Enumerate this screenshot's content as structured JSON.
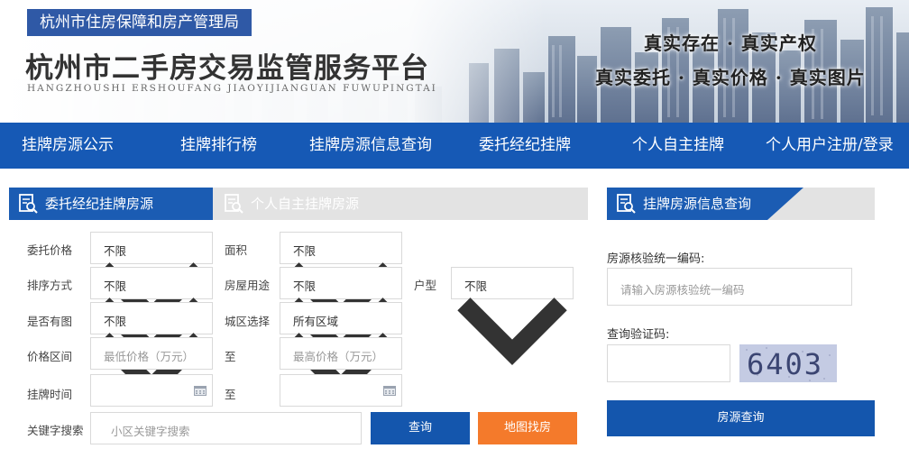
{
  "header": {
    "bureau": "杭州市住房保障和房产管理局",
    "title": "杭州市二手房交易监管服务平台",
    "pinyin": "HANGZHOUSHI  ERSHOUFANG  JIAOYIJIANGUAN  FUWUPINGTAI",
    "slogan_line1": "真实存在 · 真实产权",
    "slogan_line2": "真实委托 · 真实价格 · 真实图片"
  },
  "nav": [
    "挂牌房源公示",
    "挂牌排行榜",
    "挂牌房源信息查询",
    "委托经纪挂牌",
    "个人自主挂牌",
    "个人用户注册/登录"
  ],
  "left_panel": {
    "tab_active": "委托经纪挂牌房源",
    "tab_inactive": "个人自主挂牌房源",
    "labels": {
      "price": "委托价格",
      "area": "面积",
      "sort": "排序方式",
      "usage": "房屋用途",
      "layout": "户型",
      "has_image": "是否有图",
      "district": "城区选择",
      "price_range": "价格区间",
      "to1": "至",
      "list_time": "挂牌时间",
      "to2": "至",
      "keyword": "关键字搜索"
    },
    "values": {
      "price": "不限",
      "area": "不限",
      "sort": "不限",
      "usage": "不限",
      "layout": "不限",
      "has_image": "不限",
      "district": "所有区域"
    },
    "placeholders": {
      "min_price": "最低价格（万元）",
      "max_price": "最高价格（万元）",
      "keyword": "小区关键字搜索"
    },
    "buttons": {
      "query": "查询",
      "map": "地图找房"
    }
  },
  "right_panel": {
    "tab": "挂牌房源信息查询",
    "code_label": "房源核验统一编码:",
    "code_placeholder": "请输入房源核验统一编码",
    "verify_label": "查询验证码:",
    "captcha": "6403",
    "button": "房源查询"
  },
  "colors": {
    "nav_blue": "#1659b5",
    "tab_blue": "#1b5cb3",
    "orange": "#f47a2b",
    "button_blue": "#1456ad"
  }
}
